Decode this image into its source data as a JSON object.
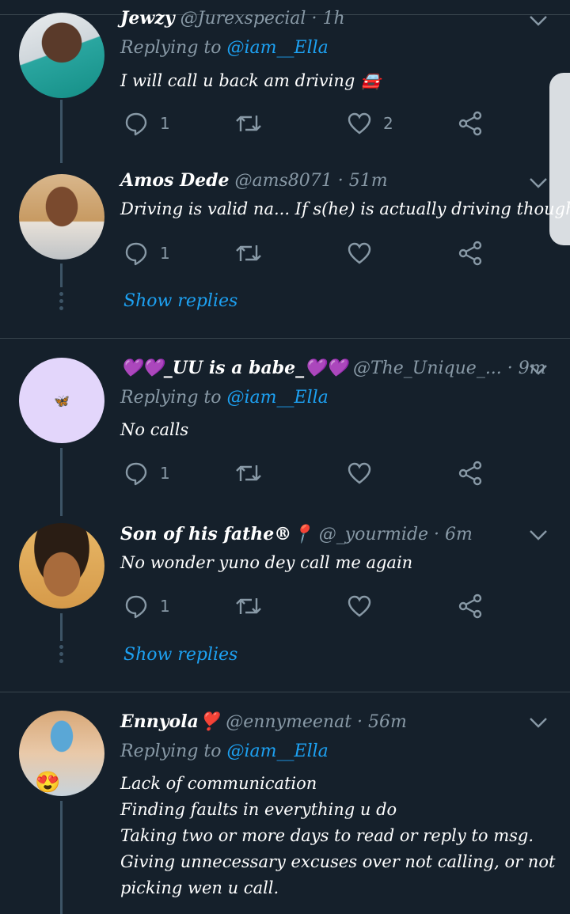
{
  "theme": {
    "background": "#15202b",
    "muted": "#8899a6",
    "accent": "#1da1f2",
    "divider": "#38444d"
  },
  "tweets": [
    {
      "name": "Jewzy",
      "handle": "@Jurexspecial",
      "time": "· 1h",
      "reply_prefix": "Replying to",
      "reply_to": "@iam__Ella",
      "text": [
        "I will call u back am driving 🚘"
      ],
      "reply_count": "1",
      "retweet_count": "",
      "like_count": "2"
    },
    {
      "name": "Amos Dede",
      "handle": "@ams8071",
      "time": "· 51m",
      "text": [
        "Driving is valid na... If s(he) is actually driving though."
      ],
      "reply_count": "1",
      "retweet_count": "",
      "like_count": ""
    },
    {
      "name": "💜💜_UU is a babe_💜💜",
      "handle": "@The_Unique_...",
      "time": "· 9m",
      "reply_prefix": "Replying to",
      "reply_to": "@iam__Ella",
      "avatar_glyph": "🦋",
      "text": [
        "No calls"
      ],
      "reply_count": "1",
      "retweet_count": "",
      "like_count": ""
    },
    {
      "name": "Son of his fathe®📍",
      "handle": "@_yourmide",
      "time": "· 6m",
      "text": [
        "No wonder yuno dey call me again"
      ],
      "reply_count": "1",
      "retweet_count": "",
      "like_count": ""
    },
    {
      "name": "Ennyola❣️",
      "handle": "@ennymeenat",
      "time": "· 56m",
      "reply_prefix": "Replying to",
      "reply_to": "@iam__Ella",
      "avatar_glyph": "😍",
      "text": [
        "Lack of communication",
        "Finding faults in everything u do",
        "Taking two or more days to read or reply to msg.",
        "Giving unnecessary excuses over not calling, or not",
        "picking wen u call."
      ]
    }
  ],
  "show_replies_label": "Show replies",
  "icons": {
    "reply": "reply-icon",
    "retweet": "retweet-icon",
    "like": "heart-icon",
    "share": "share-icon",
    "more": "chevron-down-icon"
  }
}
